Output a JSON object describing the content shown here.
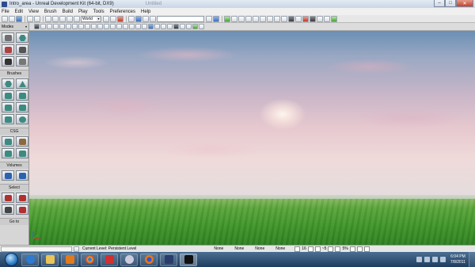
{
  "window": {
    "title": "Intro_area - Unreal Development Kit (64-bit, DX9)",
    "ghost_title": "Untitled",
    "minimize": "–",
    "maximize": "□",
    "close": "✕"
  },
  "menu": [
    "File",
    "Edit",
    "View",
    "Brush",
    "Build",
    "Play",
    "Tools",
    "Preferences",
    "Help"
  ],
  "toolbar": {
    "world_select": "World",
    "world_arrow": "▾"
  },
  "left_panel": {
    "modes_label": "Modes",
    "modes_arrow": "▾",
    "groups": {
      "brushes": "Brushes",
      "csg": "CSG",
      "volumes": "Volumes",
      "select": "Select",
      "go_to": "Go to"
    }
  },
  "status_bar": {
    "current_level": "Current Level:  Persistent Level",
    "none_1": "None",
    "none_2": "None",
    "none_3": "None",
    "none_4": "None",
    "grid_value": "16",
    "rot_value": "~5",
    "scale_value": "5%"
  },
  "taskbar": {
    "time": "6:04 PM",
    "date": "7/8/2011"
  },
  "colors": {
    "titlebar": "#c9d6e6",
    "sky_top": "#6b8fb4",
    "sky_glow": "#efdad9",
    "ground": "#3f952a",
    "taskbar": "#1f3d5e"
  }
}
